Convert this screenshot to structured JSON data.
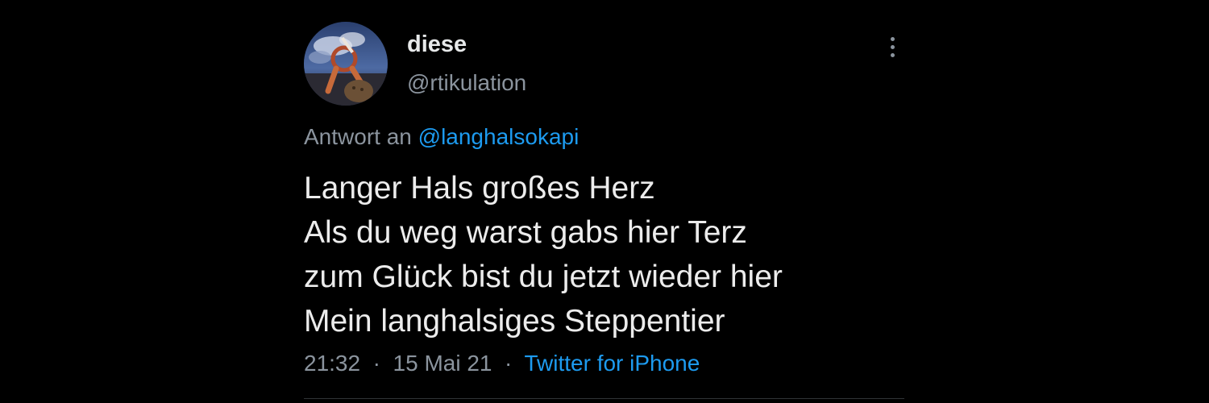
{
  "user": {
    "display_name": "diese",
    "handle": "@rtikulation",
    "avatar_icon": "profile-photo"
  },
  "reply": {
    "prefix": "Antwort an",
    "mention": "@langhalsokapi"
  },
  "tweet": {
    "lines": [
      "Langer Hals großes Herz",
      "Als du weg warst gabs hier Terz",
      "zum Glück bist du jetzt wieder hier",
      "Mein langhalsiges Steppentier"
    ]
  },
  "meta": {
    "time": "21:32",
    "date": "15 Mai 21",
    "separator": "·",
    "source": "Twitter for iPhone"
  },
  "menu": {
    "icon": "more-vertical-icon"
  },
  "colors": {
    "background": "#000000",
    "text": "#e7e9ea",
    "secondary": "#8b949e",
    "link": "#1d9bf0"
  }
}
